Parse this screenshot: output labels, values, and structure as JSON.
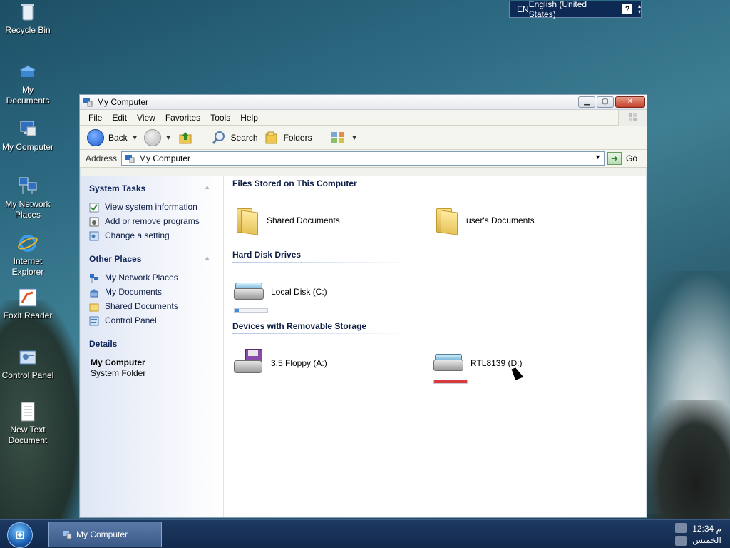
{
  "desktop": {
    "icons": [
      {
        "label": "Recycle Bin"
      },
      {
        "label": "My Documents"
      },
      {
        "label": "My Computer"
      },
      {
        "label": "My Network Places"
      },
      {
        "label": "Internet Explorer"
      },
      {
        "label": "Foxit Reader"
      },
      {
        "label": "Control Panel"
      },
      {
        "label": "New Text Document"
      }
    ]
  },
  "langbar": {
    "code": "EN",
    "language": "English (United States)",
    "help": "?"
  },
  "window": {
    "title": "My Computer",
    "menu": [
      "File",
      "Edit",
      "View",
      "Favorites",
      "Tools",
      "Help"
    ],
    "toolbar": {
      "back": "Back",
      "search": "Search",
      "folders": "Folders"
    },
    "address": {
      "label": "Address",
      "value": "My Computer",
      "go": "Go"
    },
    "tasks": {
      "system": {
        "title": "System Tasks",
        "items": [
          "View system information",
          "Add or remove programs",
          "Change a setting"
        ]
      },
      "other": {
        "title": "Other Places",
        "items": [
          "My Network Places",
          "My Documents",
          "Shared Documents",
          "Control Panel"
        ]
      },
      "details": {
        "title": "Details",
        "name": "My Computer",
        "type": "System Folder"
      }
    },
    "sections": [
      {
        "title": "Files Stored on This Computer",
        "items": [
          "Shared Documents",
          "user's Documents"
        ]
      },
      {
        "title": "Hard Disk Drives",
        "items": [
          "Local Disk (C:)"
        ]
      },
      {
        "title": "Devices with Removable Storage",
        "items": [
          "3.5 Floppy (A:)",
          "RTL8139 (D:)"
        ]
      }
    ],
    "usage": {
      "local_disk_c": 0.12,
      "rtl8139_d": 1.0
    }
  },
  "taskbar": {
    "start": "⊞",
    "active_task": "My Computer",
    "clock": {
      "time": "12:34 م",
      "day": "الخميس"
    }
  }
}
